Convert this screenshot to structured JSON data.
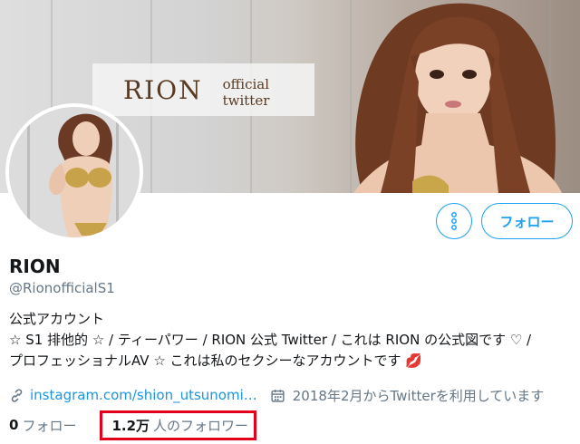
{
  "banner": {
    "title": "RION",
    "subtitle": "official twitter"
  },
  "actions": {
    "more_icon": "more-vertical-icon",
    "follow_label": "フォロー"
  },
  "profile": {
    "name": "RION",
    "handle": "@RionofficialS1",
    "bio_lines": [
      "公式アカウント",
      "☆ S1 排他的 ☆ / ティーパワー / RION 公式 Twitter / これは RION の公式図です ♡ /",
      "プロフェッショナルAV ☆ これは私のセクシーなアカウントです 💋"
    ],
    "link_icon": "link-icon",
    "website": "instagram.com/shion_utsunomi…",
    "calendar_icon": "calendar-icon",
    "joined": "2018年2月からTwitterを利用しています"
  },
  "stats": {
    "following_count": "0",
    "following_label": "フォロー",
    "followers_count": "1.2万",
    "followers_label": "人のフォロワー"
  },
  "colors": {
    "accent": "#1da1f2",
    "highlight_box": "#e3001b"
  }
}
